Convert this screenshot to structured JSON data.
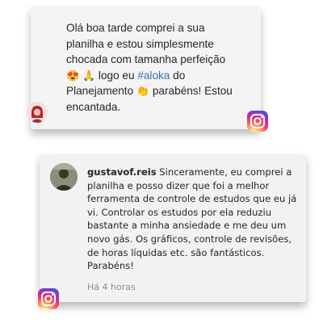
{
  "comment1": {
    "line1": "Olá boa tarde comprei a sua",
    "line2": "planilha e estou simplesmente",
    "line3": "chocada com tamanha perfeição",
    "emoji1": "😍",
    "emoji2": "🙏",
    "line4_text": " logo eu ",
    "hashtag": "#aloka",
    "line4_end": " do",
    "line5_text": "Planejamento ",
    "emoji3": "👏",
    "line5_end": " parabéns! Estou",
    "line6": "encantada."
  },
  "comment2": {
    "username": "gustavof.reis",
    "text": " Sinceramente, eu comprei a planilha e posso dizer que foi a melhor ferramenta de controle de estudos que eu já vi. Controlar os estudos por ela reduziu bastante a minha ansiedade e me deu um novo gás. Os gráficos, controle de revisões, de horas líquidas etc. são fantásticos. Parabéns!",
    "time": "Há 4 horas"
  },
  "icons": {
    "ig1": "instagram-icon",
    "ig2": "instagram-icon"
  }
}
